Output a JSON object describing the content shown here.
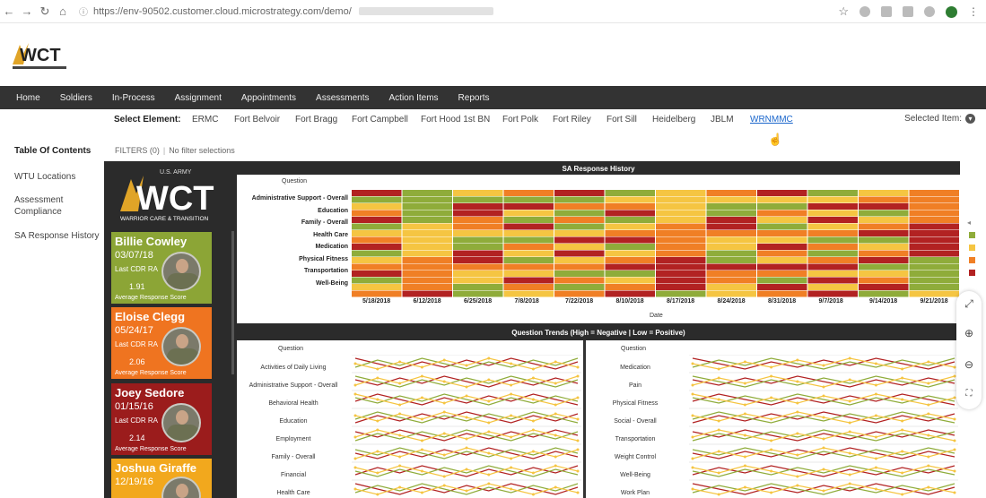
{
  "browser": {
    "url": "https://env-90502.customer.cloud.microstrategy.com/demo/"
  },
  "brand": {
    "logo_text": "WCT",
    "logo_sub": "U.S. ARMY WARRIOR CARE"
  },
  "main_nav": [
    "Home",
    "Soldiers",
    "In-Process",
    "Assignment",
    "Appointments",
    "Assessments",
    "Action Items",
    "Reports"
  ],
  "select_element": {
    "label": "Select Element:",
    "items": [
      "ERMC",
      "Fort Belvoir",
      "Fort Bragg",
      "Fort Campbell",
      "Fort Hood 1st BN",
      "Fort Polk",
      "Fort Riley",
      "Fort Sill",
      "Heidelberg",
      "JBLM",
      "WRNMMC"
    ],
    "active": "WRNMMC",
    "selected_label": "Selected Item:"
  },
  "sidebar": {
    "title": "Table Of Contents",
    "items": [
      "WTU Locations",
      "Assessment Compliance",
      "SA Response History"
    ]
  },
  "filters": {
    "label": "FILTERS (0)",
    "status": "No filter selections"
  },
  "wct_banner": {
    "top": "U.S. ARMY",
    "main": "WCT",
    "bottom": "WARRIOR CARE & TRANSITION"
  },
  "cards": [
    {
      "name": "Billie Cowley",
      "date": "03/07/18",
      "label": "Last CDR RA",
      "score": "1.91",
      "sub": "Average Response Score",
      "color": "#8ca536"
    },
    {
      "name": "Eloise Clegg",
      "date": "05/24/17",
      "label": "Last CDR RA",
      "score": "2.06",
      "sub": "Average Response Score",
      "color": "#ef7420"
    },
    {
      "name": "Joey Sedore",
      "date": "01/15/16",
      "label": "Last CDR RA",
      "score": "2.14",
      "sub": "Average Response Score",
      "color": "#9b1c1c"
    },
    {
      "name": "Joshua Giraffe",
      "date": "12/19/16",
      "label": "",
      "score": "",
      "sub": "",
      "color": "#f2a81d"
    }
  ],
  "heatmap": {
    "title": "SA Response History",
    "question_header": "Question",
    "questions": [
      "Administrative Support - Overall",
      "Education",
      "Family - Overall",
      "Health Care",
      "Medication",
      "Physical Fitness",
      "Transportation",
      "Well-Being"
    ],
    "dates": [
      "5/18/2018",
      "6/12/2018",
      "6/25/2018",
      "7/8/2018",
      "7/22/2018",
      "8/10/2018",
      "8/17/2018",
      "8/24/2018",
      "8/31/2018",
      "9/7/2018",
      "9/14/2018",
      "9/21/2018"
    ],
    "axis_label": "Date",
    "colors": {
      "red": "#b22222",
      "orange": "#f07f25",
      "yellow": "#f5c542",
      "green": "#8fac3a"
    }
  },
  "trends": {
    "title": "Question Trends (High = Negative | Low = Positive)",
    "question_header": "Question",
    "left_questions": [
      "Activities of Daily Living",
      "Administrative Support - Overall",
      "Behavioral Health",
      "Education",
      "Employment",
      "Family - Overall",
      "Financial",
      "Health Care"
    ],
    "right_questions": [
      "Medication",
      "Pain",
      "Physical Fitness",
      "Social - Overall",
      "Transportation",
      "Weight Control",
      "Well-Being",
      "Work Plan"
    ],
    "series_colors": [
      "#b22222",
      "#8fac3a",
      "#f5c542"
    ]
  },
  "legend": {
    "colors": [
      "#8fac3a",
      "#f5c542",
      "#f07f25",
      "#b22222"
    ]
  }
}
